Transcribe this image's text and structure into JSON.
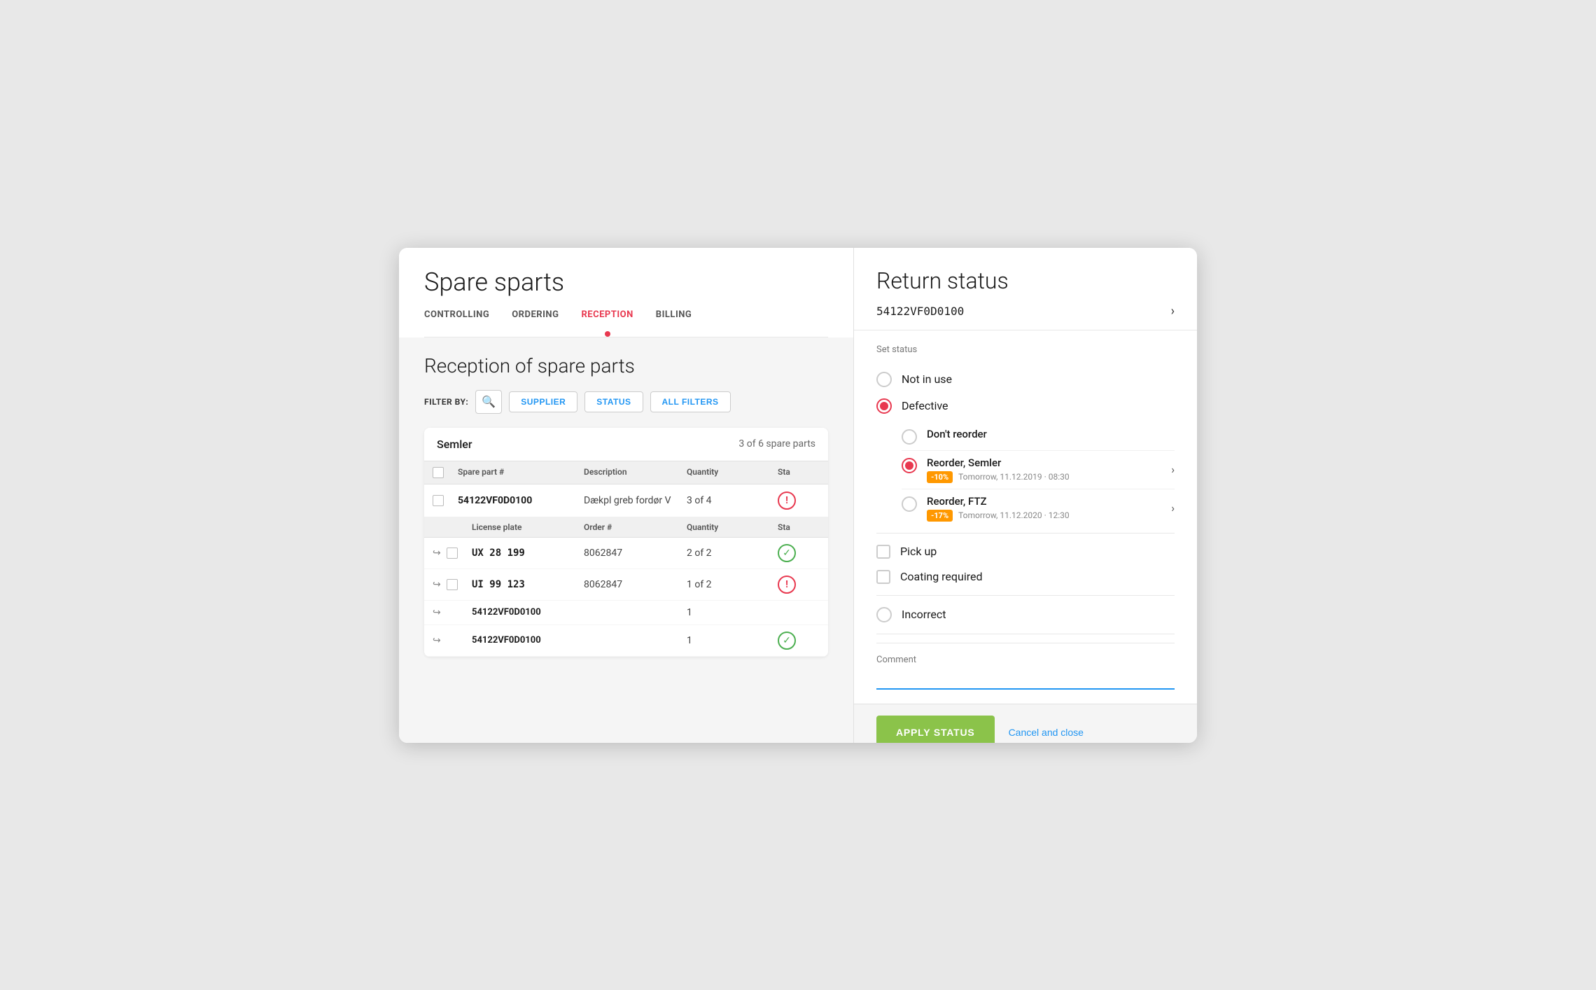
{
  "app": {
    "title": "Spare sparts"
  },
  "nav": {
    "tabs": [
      {
        "id": "controlling",
        "label": "CONTROLLING",
        "active": false
      },
      {
        "id": "ordering",
        "label": "ORDERING",
        "active": false
      },
      {
        "id": "reception",
        "label": "RECEPTION",
        "active": true
      },
      {
        "id": "billing",
        "label": "BILLING",
        "active": false
      }
    ]
  },
  "left": {
    "section_title": "Reception of spare parts",
    "filter_label": "FILTER BY:",
    "filter_supplier": "SUPPLIER",
    "filter_status": "STATUS",
    "filter_all": "ALL FILTERS",
    "supplier_name": "Semler",
    "supplier_count": "3 of 6 spare parts",
    "table_headers": [
      "",
      "Spare part #",
      "Description",
      "Quantity",
      "Sta"
    ],
    "sub_headers": [
      "",
      "",
      "License plate",
      "Order #",
      "Quantity",
      "Sta"
    ],
    "parts": [
      {
        "id": "54122VF0D0100",
        "description": "Dækpl greb fordør V",
        "quantity": "3 of 4",
        "status": "red"
      }
    ],
    "sub_rows": [
      {
        "license_plate": "UX 28 199",
        "order_num": "8062847",
        "quantity": "2 of 2",
        "status": "green"
      },
      {
        "license_plate": "UI 99 123",
        "order_num": "8062847",
        "quantity": "1 of 2",
        "status": "red"
      }
    ],
    "extra_rows": [
      {
        "id": "54122VF0D0100",
        "quantity": "1"
      },
      {
        "id": "54122VF0D0100",
        "quantity": "1",
        "status": "green"
      }
    ]
  },
  "right": {
    "title": "Return status",
    "part_id": "54122VF0D0100",
    "set_status_label": "Set status",
    "radio_options": [
      {
        "id": "not-in-use",
        "label": "Not in use",
        "selected": false
      },
      {
        "id": "defective",
        "label": "Defective",
        "selected": true
      },
      {
        "id": "incorrect",
        "label": "Incorrect",
        "selected": false
      }
    ],
    "sub_options": [
      {
        "id": "dont-reorder",
        "label": "Don't reorder",
        "selected": false
      },
      {
        "id": "reorder-semler",
        "label": "Reorder, Semler",
        "selected": true,
        "discount": "-10%",
        "date": "Tomorrow, 11.12.2019 · 08:30"
      },
      {
        "id": "reorder-ftz",
        "label": "Reorder, FTZ",
        "selected": false,
        "discount": "-17%",
        "date": "Tomorrow, 11.12.2020 · 12:30"
      }
    ],
    "checkbox_options": [
      {
        "id": "pick-up",
        "label": "Pick up",
        "checked": false
      },
      {
        "id": "coating-required",
        "label": "Coating required",
        "checked": false
      }
    ],
    "comment_label": "Comment",
    "comment_placeholder": "",
    "apply_button": "APPLY STATUS",
    "cancel_button": "Cancel and close"
  }
}
